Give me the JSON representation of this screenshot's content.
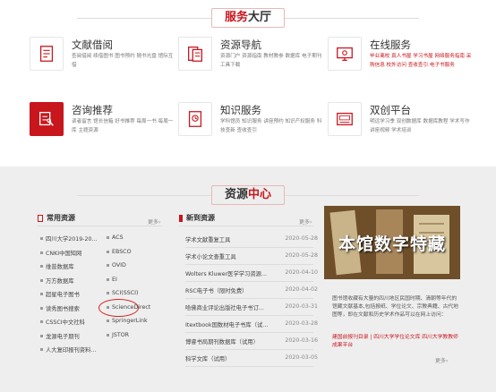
{
  "services": {
    "title_red": "服务",
    "title_dark": "大厅",
    "items": [
      {
        "name": "文献借阅",
        "icon": "document-list-icon",
        "desc": "查阅借阅 续借图书 图书预约 随书光盘 馆际互借"
      },
      {
        "name": "资源导航",
        "icon": "catalog-icon",
        "desc": "资源门户 资源指南 教材教参 数据库 电子期刊 工具下载"
      },
      {
        "name": "在线服务",
        "icon": "online-service-icon",
        "desc": "毕业离校 真人书屋 学习书屋 网络服务指南 采购信息 校外访问 查收查引 电子书服务"
      },
      {
        "name": "咨询推荐",
        "icon": "consult-icon",
        "desc": "读者留言 馆长信箱 好书推荐 每周一书 每周一库 主题资源"
      },
      {
        "name": "知识服务",
        "icon": "knowledge-icon",
        "desc": "学科馆员 知识服务 讲座预约 知识产权服务 科技查新 查收查引"
      },
      {
        "name": "双创平台",
        "icon": "scit-icon",
        "desc": "明远学习季 双创数据库 数据库教程 学术写作 讲座视频 学术培训"
      }
    ]
  },
  "resources": {
    "title_dark": "资源",
    "title_red": "中心",
    "common": {
      "heading": "常用资源",
      "more": "更多",
      "left": [
        "四川大学2019-20...",
        "CNKI中国知网",
        "维普数据库",
        "万方数据库",
        "超星电子图书",
        "读秀图书搜索",
        "CSSCI中文社科",
        "龙源电子期刊",
        "人大复印报刊资料..."
      ],
      "right": [
        "ACS",
        "EBSCO",
        "OVID",
        "EI",
        "SCI(SSCI)",
        "ScienceDirect",
        "SpringerLink",
        "JSTOR"
      ]
    },
    "news": {
      "heading": "新到资源",
      "more": "更多",
      "items": [
        {
          "title": "学术文献重复工具",
          "date": "2020-05-28"
        },
        {
          "title": "学术小论文查重工具",
          "date": "2020-05-28"
        },
        {
          "title": "Wolters Kluwer医学学习资源...",
          "date": "2020-04-10"
        },
        {
          "title": "RSC电子书（限时免费）",
          "date": "2020-04-02"
        },
        {
          "title": "哈佛商业评论出版社电子书订...",
          "date": "2020-03-31"
        },
        {
          "title": "Itextbook国数材电子书库（试...",
          "date": "2020-03-28"
        },
        {
          "title": "博睿书局期刊数据库（试用）",
          "date": "2020-03-16"
        },
        {
          "title": "科学文库（试用）",
          "date": "2020-03-05"
        }
      ]
    },
    "feature": {
      "image_caption": "本馆数字特藏",
      "text": "图书馆收藏有大量的四川地区民国时期、清朝等年代的馆藏文献基本,包括报纸、学位论文、宗教典籍、古代地图等，即在文献和历史学术作品可以在网上访问：",
      "links": "建国前报刊目录 | 四川大学学位论文库 四川大学教教师成果平台",
      "more": "更多"
    }
  },
  "colors": {
    "accent": "#c8161d",
    "section_bg": "#eeeeee"
  }
}
